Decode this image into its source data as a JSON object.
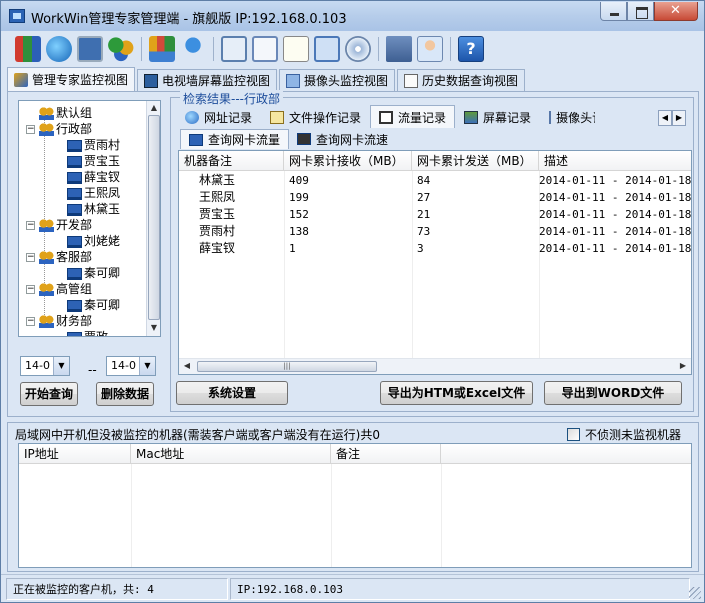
{
  "window": {
    "title": "WorkWin管理专家管理端 - 旗舰版 IP:192.168.0.103"
  },
  "toolbar": {
    "icons": [
      "books-icon",
      "globe-icon",
      "remote-screen-icon",
      "users-icon",
      "chart-icon",
      "pin-icon",
      "monitor-icon",
      "mail-icon",
      "document-search-icon",
      "copy-windows-icon",
      "disc-icon",
      "server-icon",
      "user-card-icon",
      "help-icon"
    ]
  },
  "view_tabs": [
    {
      "label": "管理专家监控视图",
      "active": true
    },
    {
      "label": "电视墙屏幕监控视图",
      "active": false
    },
    {
      "label": "摄像头监控视图",
      "active": false
    },
    {
      "label": "历史数据查询视图",
      "active": false
    }
  ],
  "tree": {
    "nodes": [
      {
        "label": "默认组",
        "type": "group",
        "level": 0,
        "expanded": false
      },
      {
        "label": "行政部",
        "type": "group",
        "level": 0,
        "expanded": true
      },
      {
        "label": "贾雨村",
        "type": "pc",
        "level": 1
      },
      {
        "label": "贾宝玉",
        "type": "pc",
        "level": 1
      },
      {
        "label": "薛宝钗",
        "type": "pc",
        "level": 1
      },
      {
        "label": "王熙凤",
        "type": "pc",
        "level": 1
      },
      {
        "label": "林黛玉",
        "type": "pc",
        "level": 1
      },
      {
        "label": "开发部",
        "type": "group",
        "level": 0,
        "expanded": true
      },
      {
        "label": "刘姥姥",
        "type": "pc",
        "level": 1
      },
      {
        "label": "客服部",
        "type": "group",
        "level": 0,
        "expanded": true
      },
      {
        "label": "秦可卿",
        "type": "pc",
        "level": 1
      },
      {
        "label": "高管组",
        "type": "group",
        "level": 0,
        "expanded": true
      },
      {
        "label": "秦可卿",
        "type": "pc",
        "level": 1
      },
      {
        "label": "财务部",
        "type": "group",
        "level": 0,
        "expanded": true
      },
      {
        "label": "贾政",
        "type": "pc",
        "level": 1
      }
    ]
  },
  "date_from": "14-0",
  "date_sep": "--",
  "date_to": "14-0",
  "buttons": {
    "start_query": "开始查询",
    "delete_data": "删除数据",
    "system_settings": "系统设置",
    "export_excel": "导出为HTM或Excel文件",
    "export_word": "导出到WORD文件"
  },
  "search_result_title": "检索结果---行政部",
  "record_tabs": [
    {
      "label": "网址记录",
      "active": false
    },
    {
      "label": "文件操作记录",
      "active": false
    },
    {
      "label": "流量记录",
      "active": true
    },
    {
      "label": "屏幕记录",
      "active": false
    },
    {
      "label": "摄像头记录",
      "active": false
    }
  ],
  "sub_tabs": [
    {
      "label": "查询网卡流量",
      "active": true
    },
    {
      "label": "查询网卡流速",
      "active": false
    }
  ],
  "traffic_table": {
    "columns": [
      "机器备注",
      "网卡累计接收（MB）",
      "网卡累计发送（MB）",
      "描述"
    ],
    "rows": [
      [
        "林黛玉",
        "409",
        "84",
        "2014-01-11 - 2014-01-18"
      ],
      [
        "王熙凤",
        "199",
        "27",
        "2014-01-11 - 2014-01-18"
      ],
      [
        "贾宝玉",
        "152",
        "21",
        "2014-01-11 - 2014-01-18"
      ],
      [
        "贾雨村",
        "138",
        "73",
        "2014-01-11 - 2014-01-18"
      ],
      [
        "薛宝钗",
        "1",
        "3",
        "2014-01-11 - 2014-01-18"
      ]
    ]
  },
  "unmonitored": {
    "title": "局域网中开机但没被监控的机器(需装客户端或客户端没有在运行)共0",
    "no_detect_label": "不侦测未监视机器",
    "no_detect_checked": false,
    "columns": [
      "IP地址",
      "Mac地址",
      "备注"
    ]
  },
  "status": {
    "monitored": "正在被监控的客户机，共: 4",
    "ip": "IP:192.168.0.103"
  }
}
